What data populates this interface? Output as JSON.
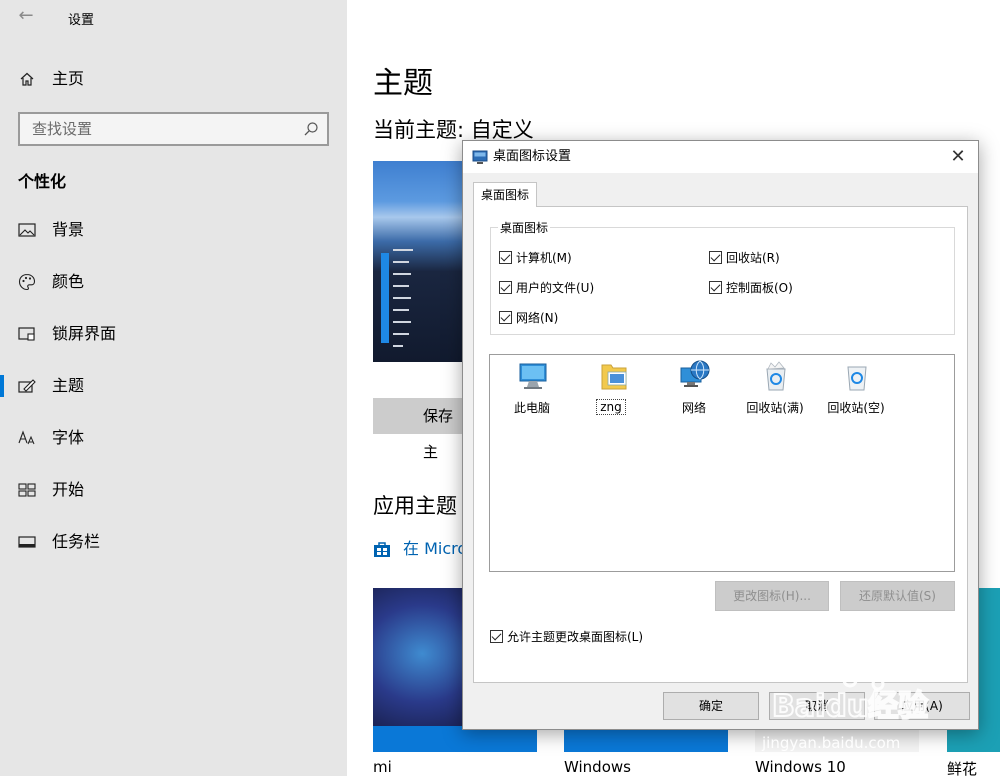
{
  "window": {
    "title": "设置",
    "back_label": "←"
  },
  "sidebar": {
    "home_label": "主页",
    "search_placeholder": "查找设置",
    "section_heading": "个性化",
    "items": [
      {
        "label": "背景"
      },
      {
        "label": "颜色"
      },
      {
        "label": "锁屏界面"
      },
      {
        "label": "主题"
      },
      {
        "label": "字体"
      },
      {
        "label": "开始"
      },
      {
        "label": "任务栏"
      }
    ],
    "selected_index": 3
  },
  "main": {
    "page_title": "主题",
    "current_theme": "当前主题: 自定义",
    "save_button": "保存主",
    "apply_title": "应用主题",
    "store_link": "在 Micro",
    "thumbnails": [
      {
        "label": "mi"
      },
      {
        "label": "Windows"
      },
      {
        "label": "Windows 10"
      },
      {
        "label": "鲜花"
      }
    ]
  },
  "dialog": {
    "title": "桌面图标设置",
    "close_label": "✕",
    "tab_label": "桌面图标",
    "group_label": "桌面图标",
    "checkboxes": [
      {
        "label": "计算机(M)",
        "checked": true
      },
      {
        "label": "回收站(R)",
        "checked": true
      },
      {
        "label": "用户的文件(U)",
        "checked": true
      },
      {
        "label": "控制面板(O)",
        "checked": true
      },
      {
        "label": "网络(N)",
        "checked": true
      }
    ],
    "icons": [
      {
        "label": "此电脑",
        "icon": "computer-icon"
      },
      {
        "label": "zng",
        "icon": "user-folder-icon"
      },
      {
        "label": "网络",
        "icon": "network-globe-icon"
      },
      {
        "label": "回收站(满)",
        "icon": "recycle-bin-full-icon"
      },
      {
        "label": "回收站(空)",
        "icon": "recycle-bin-empty-icon"
      }
    ],
    "change_icon_button": "更改图标(H)...",
    "restore_default_button": "还原默认值(S)",
    "allow_themes_label": "允许主题更改桌面图标(L)",
    "allow_themes_checked": true,
    "ok_button": "确定",
    "cancel_button": "取消",
    "apply_button": "应用(A)"
  },
  "watermark": {
    "brand": "Baidu经验",
    "url": "jingyan.baidu.com"
  },
  "colors": {
    "accent": "#0078d7",
    "link": "#0063b1",
    "sidebar_bg": "#e6e6e6",
    "dialog_bg": "#f0f0f0"
  }
}
